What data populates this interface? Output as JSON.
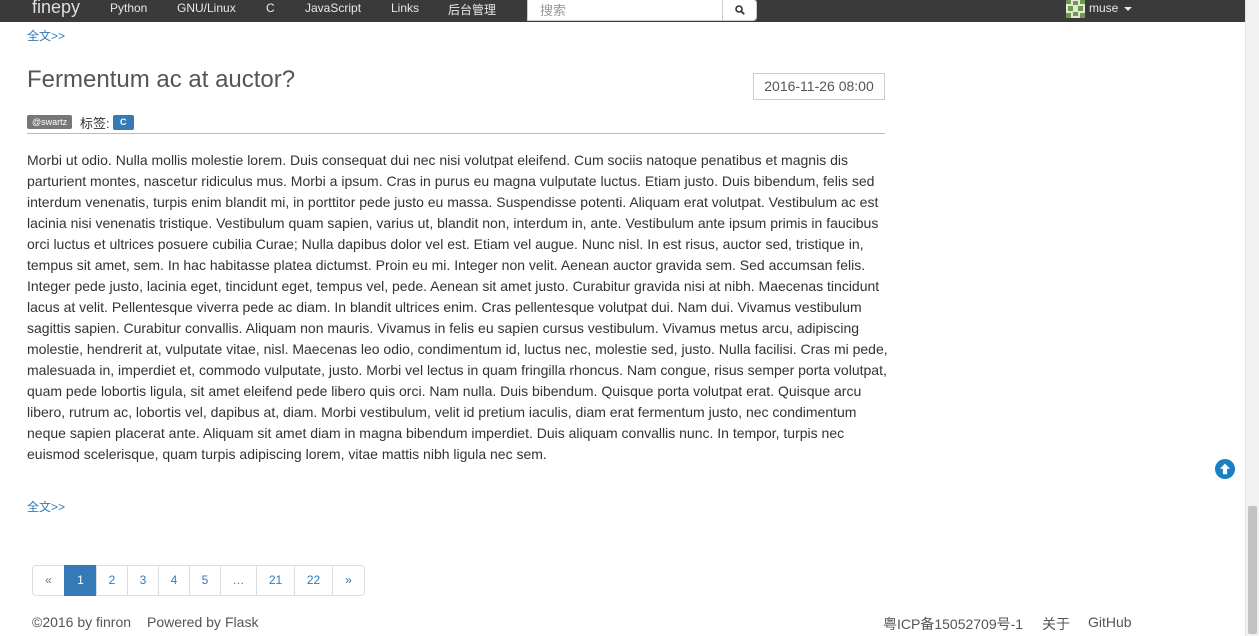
{
  "navbar": {
    "brand": "finepy",
    "links": [
      "Python",
      "GNU/Linux",
      "C",
      "JavaScript",
      "Links",
      "后台管理"
    ],
    "search_placeholder": "搜索",
    "search_icon": "search-icon",
    "user": {
      "name": "muse",
      "avatar_icon": "identicon-avatar",
      "menu_icon": "caret-down-icon"
    }
  },
  "previous_post": {
    "more_link": "全文>>"
  },
  "post": {
    "title": "Fermentum ac at auctor?",
    "date": "2016-11-26 08:00",
    "author": "@swartz",
    "tags_label": "标签:",
    "tags": [
      "C"
    ],
    "body": "Morbi ut odio. Nulla mollis molestie lorem. Duis consequat dui nec nisi volutpat eleifend. Cum sociis natoque penatibus et magnis dis parturient montes, nascetur ridiculus mus. Morbi a ipsum. Cras in purus eu magna vulputate luctus. Etiam justo. Duis bibendum, felis sed interdum venenatis, turpis enim blandit mi, in porttitor pede justo eu massa. Suspendisse potenti. Aliquam erat volutpat. Vestibulum ac est lacinia nisi venenatis tristique. Vestibulum quam sapien, varius ut, blandit non, interdum in, ante. Vestibulum ante ipsum primis in faucibus orci luctus et ultrices posuere cubilia Curae; Nulla dapibus dolor vel est. Etiam vel augue. Nunc nisl. In est risus, auctor sed, tristique in, tempus sit amet, sem. In hac habitasse platea dictumst. Proin eu mi. Integer non velit. Aenean auctor gravida sem. Sed accumsan felis. Integer pede justo, lacinia eget, tincidunt eget, tempus vel, pede. Aenean sit amet justo. Curabitur gravida nisi at nibh. Maecenas tincidunt lacus at velit. Pellentesque viverra pede ac diam. In blandit ultrices enim. Cras pellentesque volutpat dui. Nam dui. Vivamus vestibulum sagittis sapien. Curabitur convallis. Aliquam non mauris. Vivamus in felis eu sapien cursus vestibulum. Vivamus metus arcu, adipiscing molestie, hendrerit at, vulputate vitae, nisl. Maecenas leo odio, condimentum id, luctus nec, molestie sed, justo. Nulla facilisi. Cras mi pede, malesuada in, imperdiet et, commodo vulputate, justo. Morbi vel lectus in quam fringilla rhoncus. Nam congue, risus semper porta volutpat, quam pede lobortis ligula, sit amet eleifend pede libero quis orci. Nam nulla. Duis bibendum. Quisque porta volutpat erat. Quisque arcu libero, rutrum ac, lobortis vel, dapibus at, diam. Morbi vestibulum, velit id pretium iaculis, diam erat fermentum justo, nec condimentum neque sapien placerat ante. Aliquam sit amet diam in magna bibendum imperdiet. Duis aliquam convallis nunc. In tempor, turpis nec euismod scelerisque, quam turpis adipiscing lorem, vitae mattis nibh ligula nec sem.",
    "more_link": "全文>>"
  },
  "pagination": {
    "prev": "«",
    "pages": [
      "1",
      "2",
      "3",
      "4",
      "5",
      "…",
      "21",
      "22"
    ],
    "active": "1",
    "next": "»"
  },
  "footer": {
    "copyright": "©2016 by",
    "author_link": "finron",
    "powered_by": "Powered by",
    "framework_link": "Flask",
    "icp": "粤ICP备15052709号-1",
    "about_link": "关于",
    "github_link": "GitHub"
  },
  "back_to_top_icon": "arrow-up-circle-icon",
  "colors": {
    "navbar_bg": "#3a3a3a",
    "link": "#337ab7",
    "author_badge": "#777777",
    "tag_badge": "#337ab7"
  }
}
